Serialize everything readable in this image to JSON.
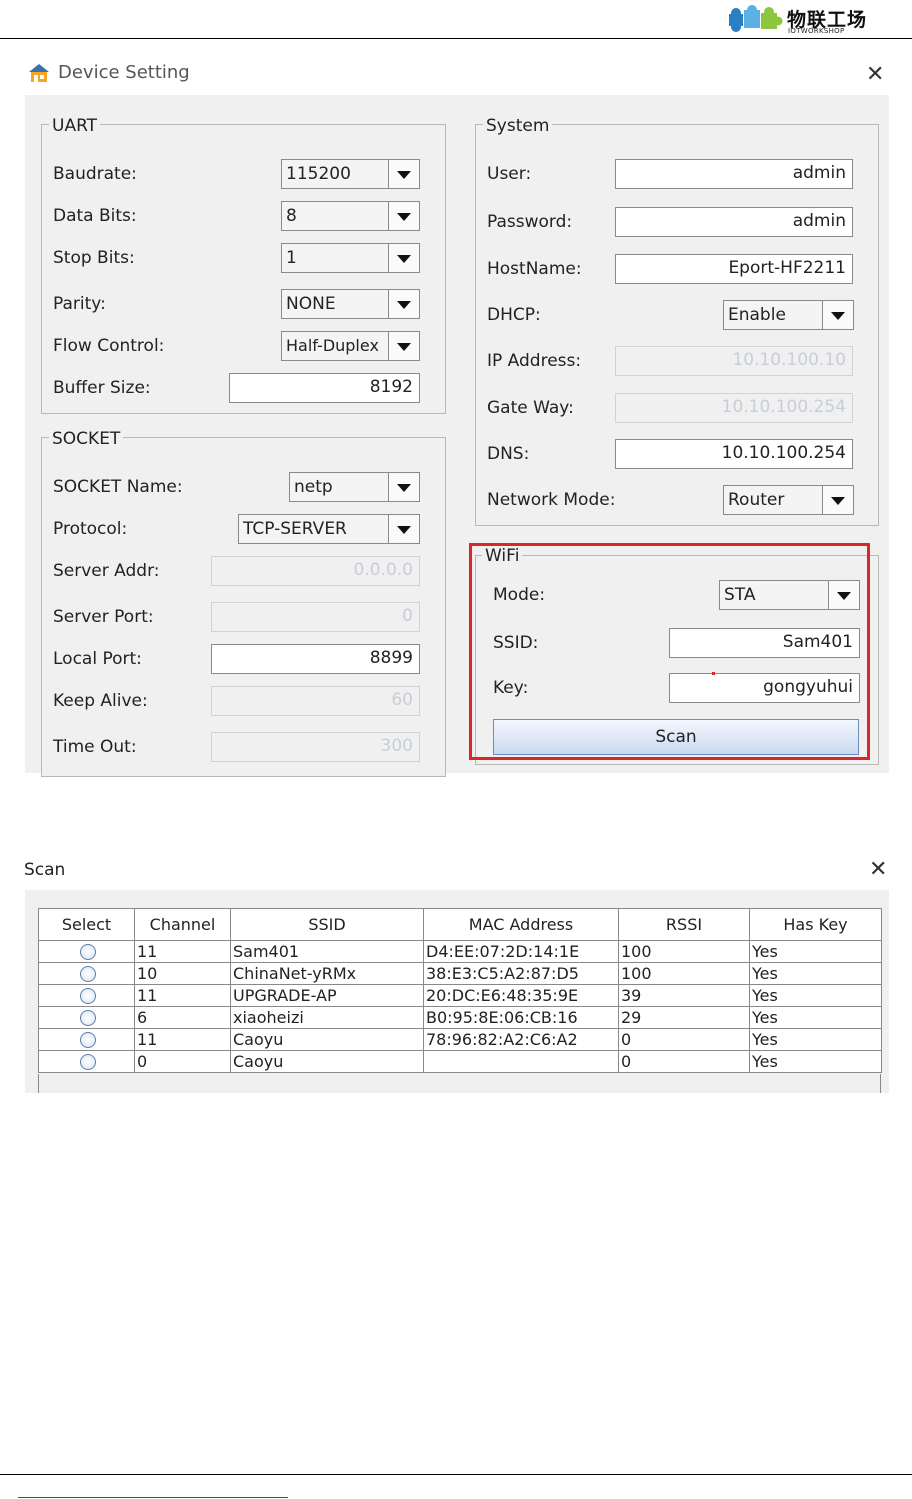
{
  "header": {
    "logo_cn": "物联工场",
    "logo_en": "IOTWORKSHOP"
  },
  "device_setting": {
    "title": "Device Setting",
    "close_glyph": "✕",
    "uart": {
      "title": "UART",
      "baudrate": {
        "label": "Baudrate:",
        "value": "115200"
      },
      "data_bits": {
        "label": "Data Bits:",
        "value": "8"
      },
      "stop_bits": {
        "label": "Stop Bits:",
        "value": "1"
      },
      "parity": {
        "label": "Parity:",
        "value": "NONE"
      },
      "flow_control": {
        "label": "Flow Control:",
        "value": "Half-Duplex"
      },
      "buffer_size": {
        "label": "Buffer Size:",
        "value": "8192"
      }
    },
    "socket": {
      "title": "SOCKET",
      "name": {
        "label": "SOCKET Name:",
        "value": "netp"
      },
      "protocol": {
        "label": "Protocol:",
        "value": "TCP-SERVER"
      },
      "server_addr": {
        "label": "Server Addr:",
        "value": "0.0.0.0"
      },
      "server_port": {
        "label": "Server Port:",
        "value": "0"
      },
      "local_port": {
        "label": "Local Port:",
        "value": "8899"
      },
      "keep_alive": {
        "label": "Keep Alive:",
        "value": "60"
      },
      "time_out": {
        "label": "Time Out:",
        "value": "300"
      }
    },
    "system": {
      "title": "System",
      "user": {
        "label": "User:",
        "value": "admin"
      },
      "password": {
        "label": "Password:",
        "value": "admin"
      },
      "hostname": {
        "label": "HostName:",
        "value": "Eport-HF2211"
      },
      "dhcp": {
        "label": "DHCP:",
        "value": "Enable"
      },
      "ip_address": {
        "label": "IP Address:",
        "value": "10.10.100.10"
      },
      "gate_way": {
        "label": "Gate Way:",
        "value": "10.10.100.254"
      },
      "dns": {
        "label": "DNS:",
        "value": "10.10.100.254"
      },
      "network_mode": {
        "label": "Network Mode:",
        "value": "Router"
      }
    },
    "wifi": {
      "title": "WiFi",
      "mode": {
        "label": "Mode:",
        "value": "STA"
      },
      "ssid": {
        "label": "SSID:",
        "value": "Sam401"
      },
      "key": {
        "label": "Key:",
        "value": "gongyuhui"
      },
      "scan_label": "Scan",
      "highlight_color": "#d9262b"
    }
  },
  "scan_dialog": {
    "title": "Scan",
    "close_glyph": "✕",
    "columns": [
      "Select",
      "Channel",
      "SSID",
      "MAC Address",
      "RSSI",
      "Has Key"
    ],
    "rows": [
      {
        "channel": "11",
        "ssid": "Sam401",
        "mac": "D4:EE:07:2D:14:1E",
        "rssi": "100",
        "has_key": "Yes"
      },
      {
        "channel": "10",
        "ssid": "ChinaNet-yRMx",
        "mac": "38:E3:C5:A2:87:D5",
        "rssi": "100",
        "has_key": "Yes"
      },
      {
        "channel": "11",
        "ssid": "UPGRADE-AP",
        "mac": "20:DC:E6:48:35:9E",
        "rssi": "39",
        "has_key": "Yes"
      },
      {
        "channel": "6",
        "ssid": "xiaoheizi",
        "mac": "B0:95:8E:06:CB:16",
        "rssi": "29",
        "has_key": "Yes"
      },
      {
        "channel": "11",
        "ssid": "Caoyu",
        "mac": "78:96:82:A2:C6:A2",
        "rssi": "0",
        "has_key": "Yes"
      },
      {
        "channel": "0",
        "ssid": "Caoyu",
        "mac": "",
        "rssi": "0",
        "has_key": "Yes"
      }
    ]
  }
}
